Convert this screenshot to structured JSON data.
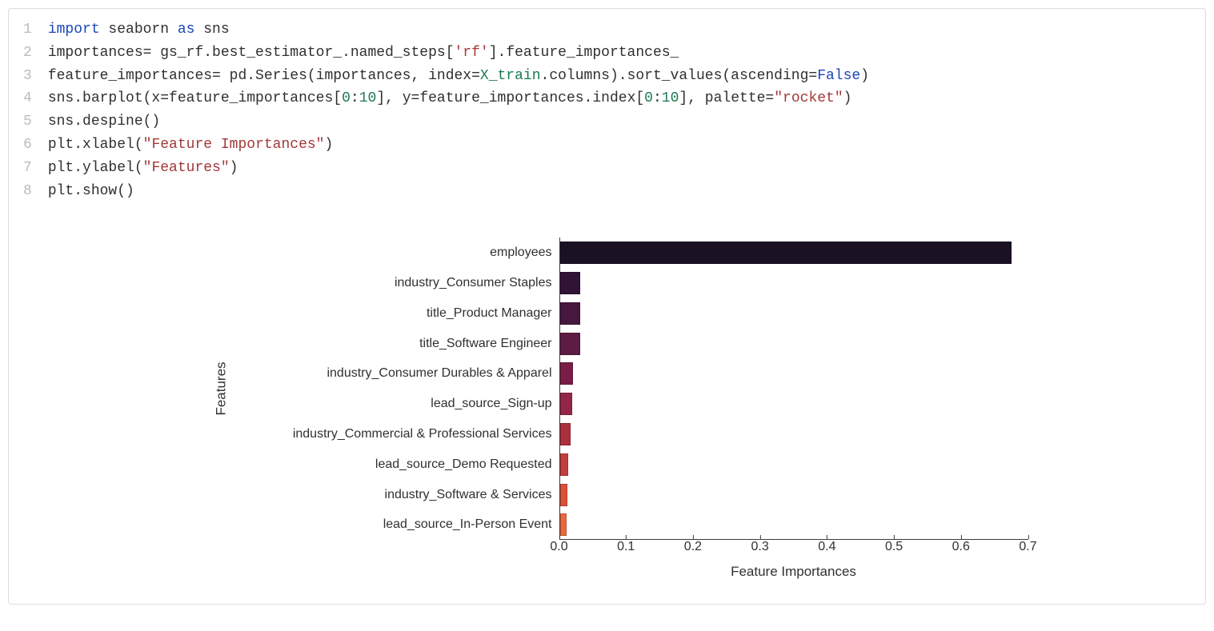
{
  "code": {
    "lines": [
      {
        "n": "1",
        "tokens": [
          {
            "t": "import",
            "c": "kw-import"
          },
          {
            "t": " seaborn "
          },
          {
            "t": "as",
            "c": "kw-as"
          },
          {
            "t": " sns"
          }
        ]
      },
      {
        "n": "2",
        "tokens": [
          {
            "t": "importances= gs_rf.best_estimator_.named_steps["
          },
          {
            "t": "'rf'",
            "c": "str"
          },
          {
            "t": "].feature_importances_"
          }
        ]
      },
      {
        "n": "3",
        "tokens": [
          {
            "t": "feature_importances= pd.Series(importances, index="
          },
          {
            "t": "X_train",
            "c": "var-green"
          },
          {
            "t": ".columns).sort_values(ascending="
          },
          {
            "t": "False",
            "c": "kw-false"
          },
          {
            "t": ")"
          }
        ]
      },
      {
        "n": "4",
        "tokens": [
          {
            "t": "sns.barplot(x=feature_importances["
          },
          {
            "t": "0",
            "c": "num"
          },
          {
            "t": ":"
          },
          {
            "t": "10",
            "c": "num"
          },
          {
            "t": "], y=feature_importances.index["
          },
          {
            "t": "0",
            "c": "num"
          },
          {
            "t": ":"
          },
          {
            "t": "10",
            "c": "num"
          },
          {
            "t": "], palette="
          },
          {
            "t": "\"rocket\"",
            "c": "str"
          },
          {
            "t": ")"
          }
        ]
      },
      {
        "n": "5",
        "tokens": [
          {
            "t": "sns.despine()"
          }
        ]
      },
      {
        "n": "6",
        "tokens": [
          {
            "t": "plt.xlabel("
          },
          {
            "t": "\"Feature Importances\"",
            "c": "str"
          },
          {
            "t": ")"
          }
        ]
      },
      {
        "n": "7",
        "tokens": [
          {
            "t": "plt.ylabel("
          },
          {
            "t": "\"Features\"",
            "c": "str"
          },
          {
            "t": ")"
          }
        ]
      },
      {
        "n": "8",
        "tokens": [
          {
            "t": "plt.show()"
          }
        ]
      }
    ]
  },
  "chart_data": {
    "type": "bar",
    "orientation": "horizontal",
    "xlabel": "Feature Importances",
    "ylabel": "Features",
    "xlim": [
      0.0,
      0.7
    ],
    "xticks": [
      0.0,
      0.1,
      0.2,
      0.3,
      0.4,
      0.5,
      0.6,
      0.7
    ],
    "xtick_labels": [
      "0.0",
      "0.1",
      "0.2",
      "0.3",
      "0.4",
      "0.5",
      "0.6",
      "0.7"
    ],
    "categories": [
      "employees",
      "industry_Consumer Staples",
      "title_Product Manager",
      "title_Software Engineer",
      "industry_Consumer Durables & Apparel",
      "lead_source_Sign-up",
      "industry_Commercial & Professional Services",
      "lead_source_Demo Requested",
      "industry_Software & Services",
      "lead_source_In-Person Event"
    ],
    "values": [
      0.675,
      0.03,
      0.03,
      0.03,
      0.02,
      0.018,
      0.016,
      0.012,
      0.011,
      0.01
    ],
    "colors": [
      "#1b1125",
      "#301336",
      "#46173f",
      "#5e1b45",
      "#781e46",
      "#932645",
      "#ac2f40",
      "#c53d3c",
      "#da5039",
      "#e9683d"
    ]
  }
}
